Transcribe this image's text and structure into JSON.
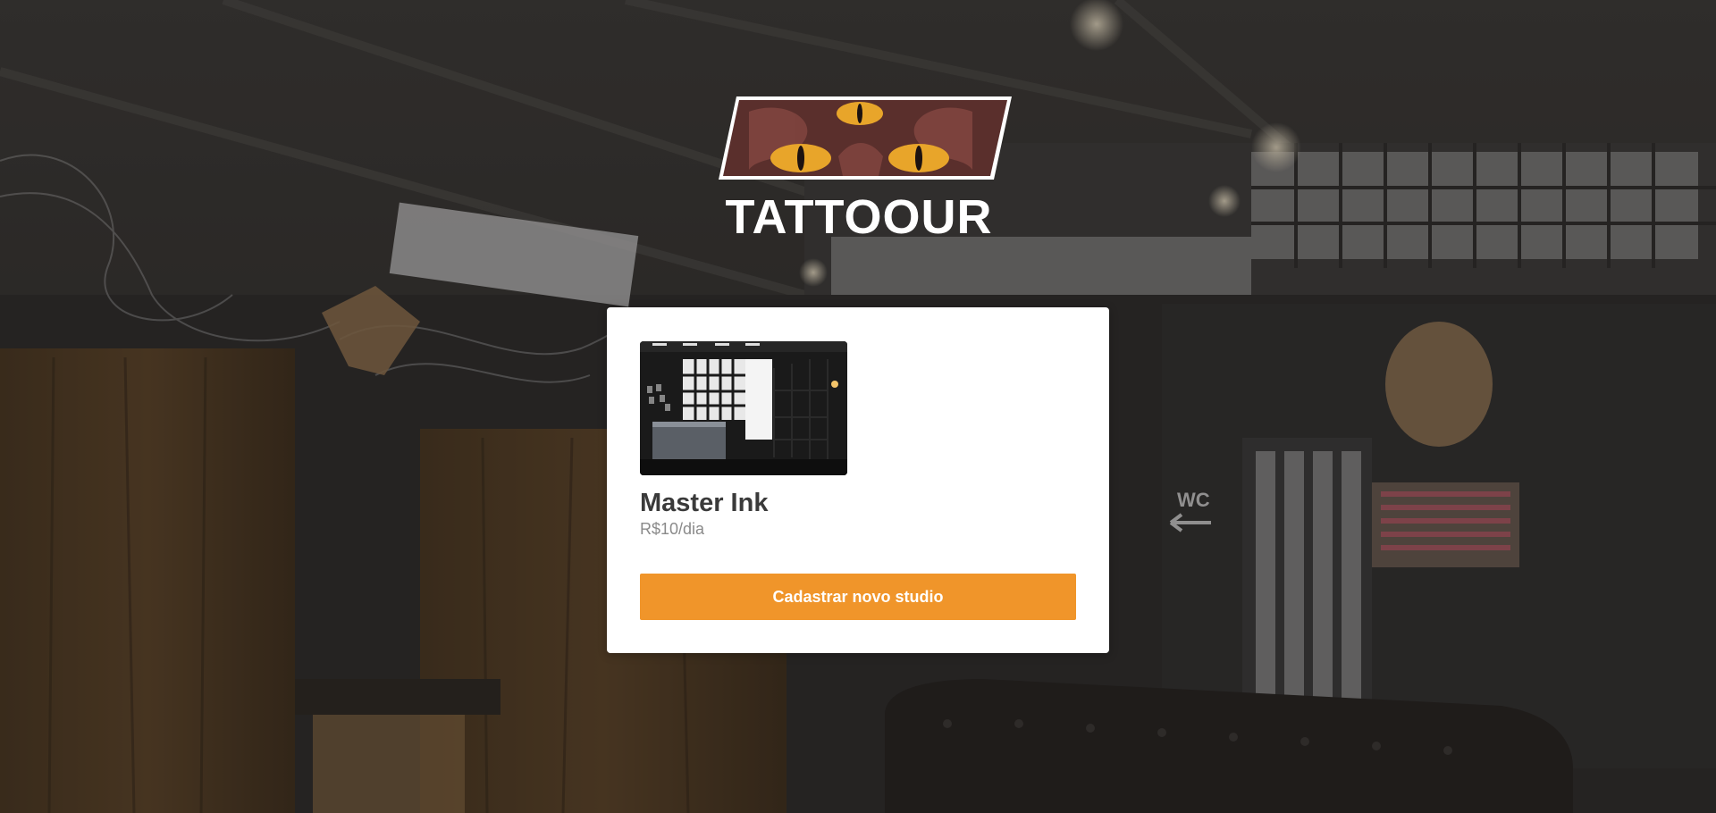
{
  "brand": {
    "name": "TATTOOUR",
    "logo_icon": "three-eyed-cat-icon",
    "accent": "#f0952a"
  },
  "studios": [
    {
      "name": "Master Ink",
      "price": "R$10/dia",
      "image_icon": "studio-interior-photo"
    }
  ],
  "actions": {
    "register_label": "Cadastrar novo studio"
  },
  "background": {
    "sign_text": "WC"
  }
}
